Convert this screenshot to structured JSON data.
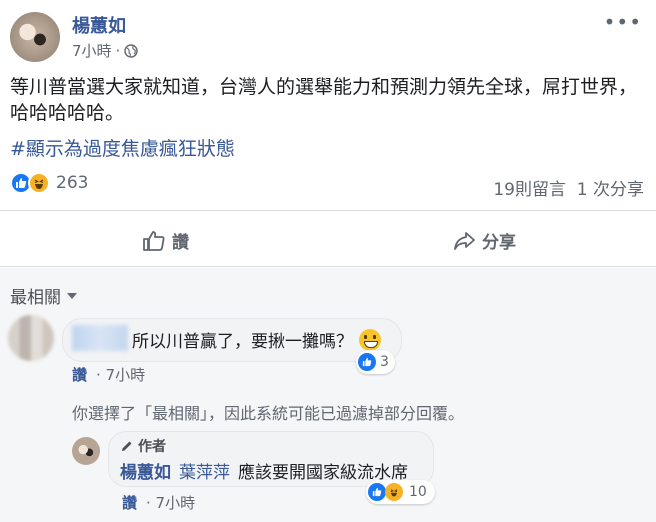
{
  "post": {
    "author": "楊蕙如",
    "time": "7小時",
    "time_sep": "·",
    "more": "•••",
    "text": "等川普當選大家就知道，台灣人的選舉能力和預測力領先全球，屌打世界，哈哈哈哈哈。",
    "hashtag": "#顯示為過度焦慮瘋狂狀態",
    "reaction_count": "263",
    "comments_shares": "19則留言  1 次分享",
    "like_label": "讚",
    "share_label": "分享"
  },
  "comments": {
    "sort_label": "最相關",
    "first": {
      "text": "所以川普贏了，要揪一攤嗎？",
      "reaction_count": "3",
      "like_label": "讚",
      "time": "· 7小時"
    },
    "filter_notice": "你選擇了「最相關」，因此系統可能已過濾掉部分回覆。",
    "reply": {
      "badge": "作者",
      "author": "楊蕙如",
      "mention": "葉萍萍",
      "text": "應該要開國家級流水席",
      "reaction_count": "10",
      "like_label": "讚",
      "time": "· 7小時"
    }
  },
  "colors": {
    "link": "#385898",
    "like": "#1877f2",
    "haha": "#f7b125",
    "muted": "#606770"
  },
  "icons": [
    "globe-icon",
    "more-icon",
    "like-reaction-icon",
    "haha-reaction-icon",
    "thumbs-up-icon",
    "share-arrow-icon",
    "caret-down-icon",
    "pencil-icon",
    "grinning-emoji-icon"
  ]
}
